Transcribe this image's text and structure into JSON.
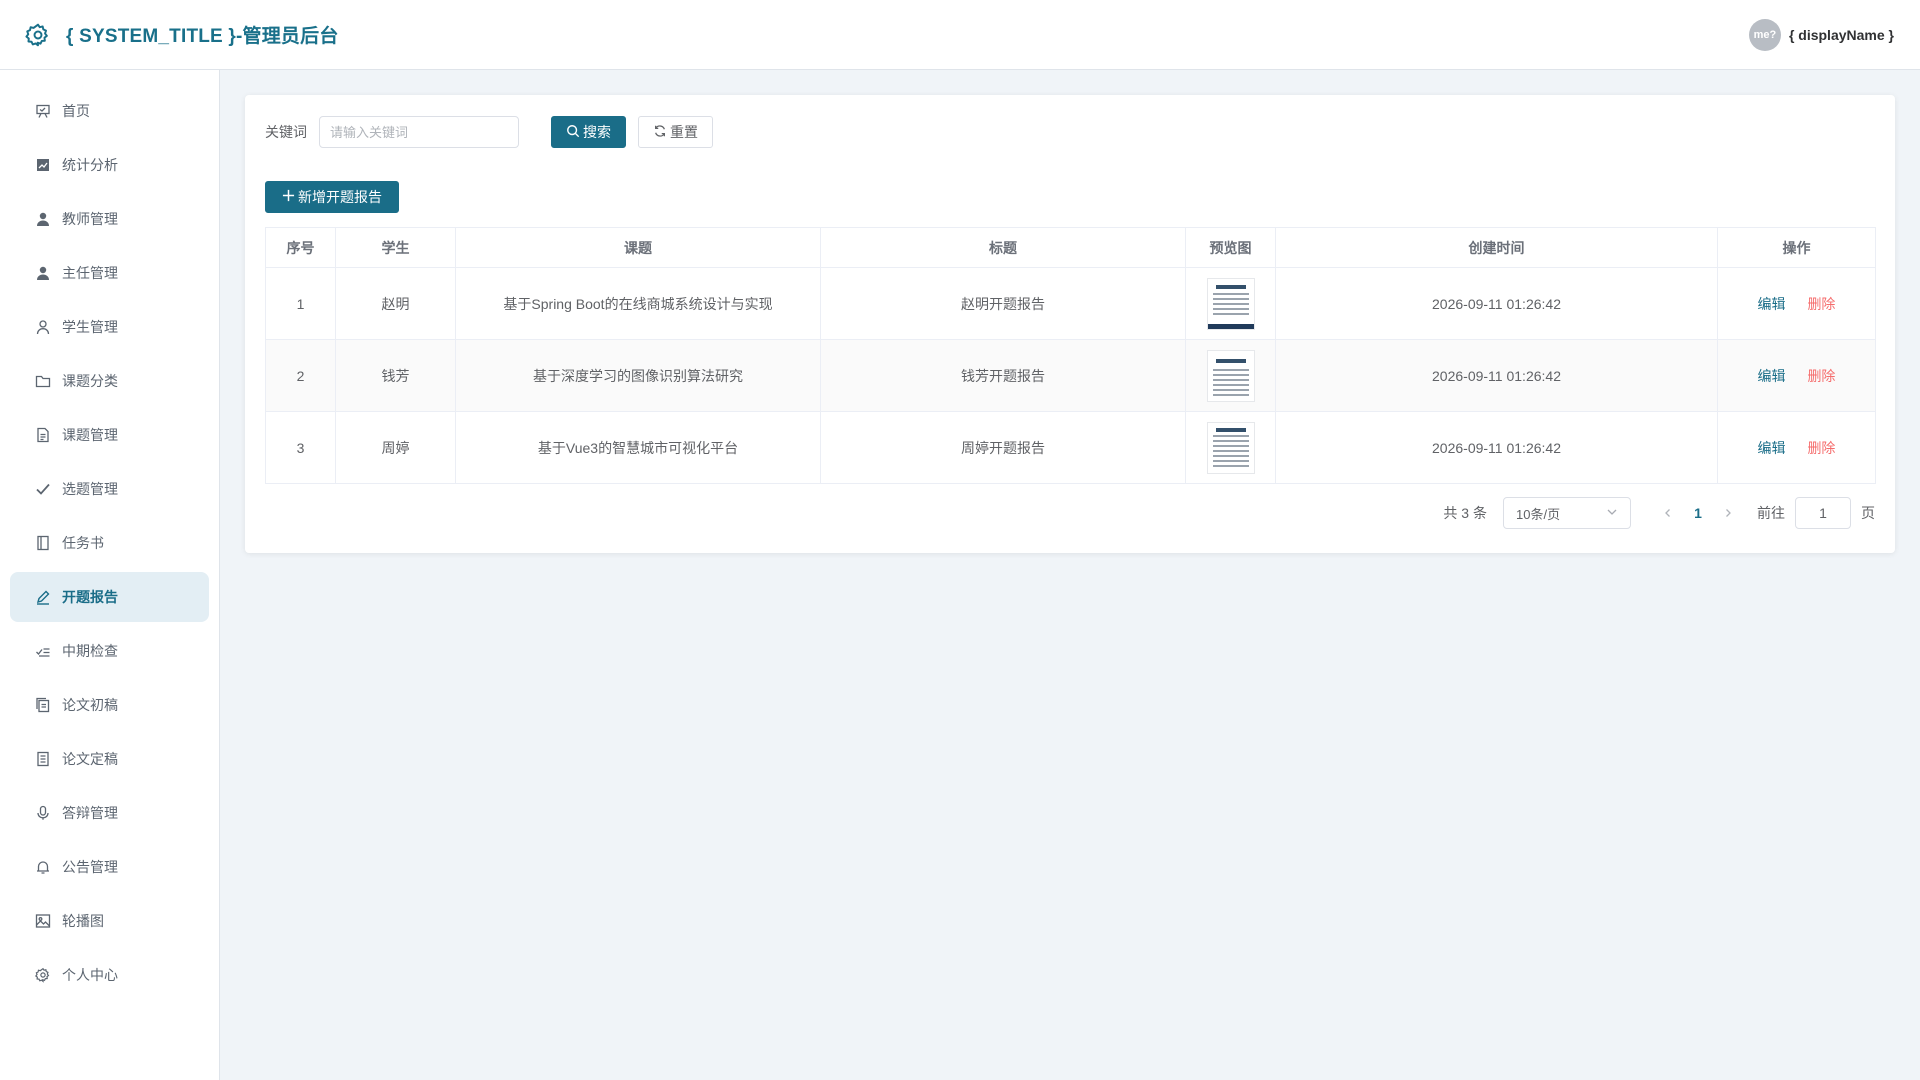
{
  "header": {
    "title": "{ SYSTEM_TITLE }-管理员后台",
    "avatar_text": "me?",
    "user_name": "{ displayName }"
  },
  "sidebar": {
    "items": [
      {
        "label": "首页",
        "icon": "presentation-icon"
      },
      {
        "label": "统计分析",
        "icon": "chart-icon"
      },
      {
        "label": "教师管理",
        "icon": "user-filled-icon"
      },
      {
        "label": "主任管理",
        "icon": "user-filled-icon"
      },
      {
        "label": "学生管理",
        "icon": "user-outline-icon"
      },
      {
        "label": "课题分类",
        "icon": "folder-icon"
      },
      {
        "label": "课题管理",
        "icon": "document-icon"
      },
      {
        "label": "选题管理",
        "icon": "check-icon"
      },
      {
        "label": "任务书",
        "icon": "notebook-icon"
      },
      {
        "label": "开题报告",
        "icon": "edit-pen-icon",
        "active": true
      },
      {
        "label": "中期检查",
        "icon": "checklist-icon"
      },
      {
        "label": "论文初稿",
        "icon": "copy-document-icon"
      },
      {
        "label": "论文定稿",
        "icon": "tickets-icon"
      },
      {
        "label": "答辩管理",
        "icon": "microphone-icon"
      },
      {
        "label": "公告管理",
        "icon": "bell-icon"
      },
      {
        "label": "轮播图",
        "icon": "picture-icon"
      },
      {
        "label": "个人中心",
        "icon": "setting-icon"
      }
    ]
  },
  "search": {
    "label": "关键词",
    "placeholder": "请输入关键词",
    "search_label": "搜索",
    "reset_label": "重置"
  },
  "toolbar": {
    "add_label": "新增开题报告"
  },
  "table": {
    "headers": [
      "序号",
      "学生",
      "课题",
      "标题",
      "预览图",
      "创建时间",
      "操作"
    ],
    "rows": [
      {
        "no": "1",
        "student": "赵明",
        "topic": "基于Spring Boot的在线商城系统设计与实现",
        "title": "赵明开题报告",
        "created": "2026-09-11 01:26:42"
      },
      {
        "no": "2",
        "student": "钱芳",
        "topic": "基于深度学习的图像识别算法研究",
        "title": "钱芳开题报告",
        "created": "2026-09-11 01:26:42"
      },
      {
        "no": "3",
        "student": "周婷",
        "topic": "基于Vue3的智慧城市可视化平台",
        "title": "周婷开题报告",
        "created": "2026-09-11 01:26:42"
      }
    ],
    "edit_label": "编辑",
    "delete_label": "删除"
  },
  "pagination": {
    "total": "共 3 条",
    "page_size": "10条/页",
    "current_page": "1",
    "goto_label": "前往",
    "goto_value": "1",
    "unit_label": "页"
  },
  "colors": {
    "primary": "#1a6d88",
    "danger": "#f56c6c",
    "active_bg": "#e3eef4",
    "page_bg": "#f0f4f8"
  }
}
